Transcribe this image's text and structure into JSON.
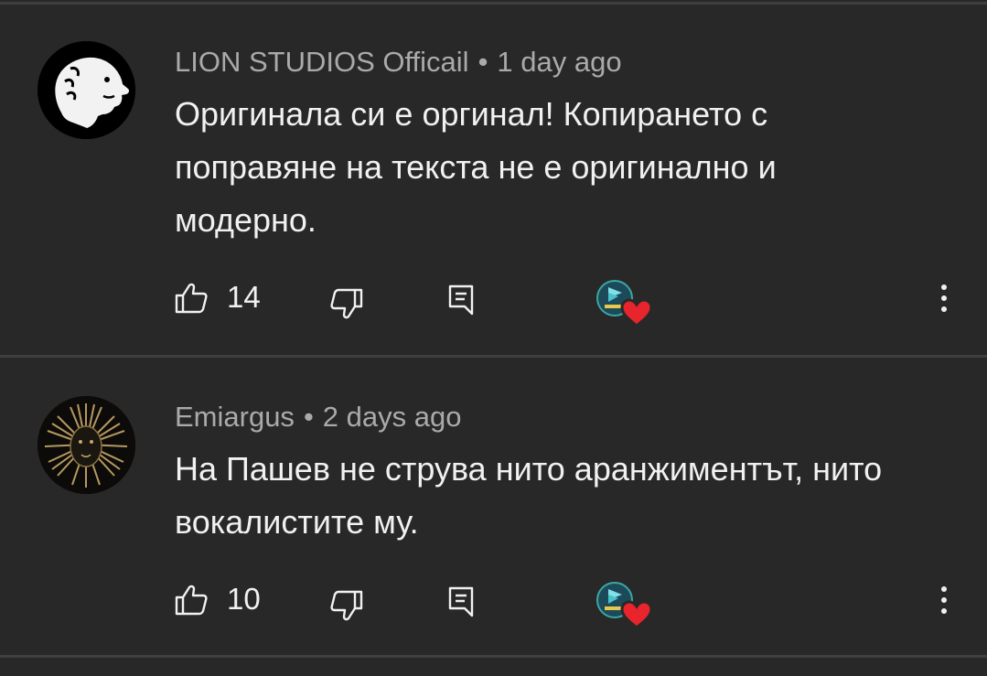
{
  "comments": [
    {
      "author": "LION STUDIOS Officail",
      "separator": "•",
      "time": "1 day ago",
      "text": "Оригинала си е оргинал! Копирането с поправяне на текста не е оригинално и модерно.",
      "likes": "14",
      "avatar_icon": "lion-head-icon",
      "creator_heart": true
    },
    {
      "author": "Emiargus",
      "separator": "•",
      "time": "2 days ago",
      "text": "На Пашев не струва нито аранжиментът, нито вокалистите му.",
      "likes": "10",
      "avatar_icon": "golden-lion-mane-icon",
      "creator_heart": true
    }
  ],
  "colors": {
    "background": "#282828",
    "divider": "#3f3f3f",
    "text_primary": "#f1f1f1",
    "text_secondary": "#aaaaaa",
    "heart": "#e8242c"
  }
}
